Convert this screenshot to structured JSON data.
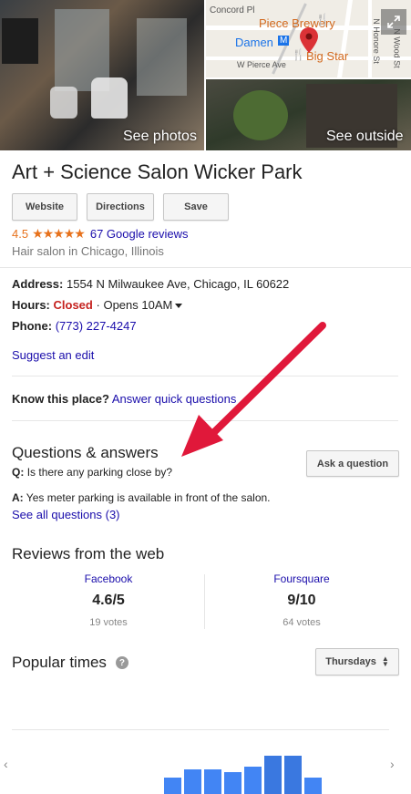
{
  "photos": {
    "main_label": "See photos",
    "outside_label": "See outside",
    "map_labels": [
      "Concord Pl",
      "Piece Brewery",
      "Damen",
      "Big Star",
      "W Pierce Ave",
      "N Honore St",
      "N Wood St"
    ],
    "expand_icon": "expand-icon"
  },
  "business": {
    "name": "Art + Science Salon Wicker Park",
    "buttons": [
      "Website",
      "Directions",
      "Save"
    ],
    "rating": "4.5",
    "stars": "★★★★★",
    "reviews_link": "67 Google reviews",
    "category": "Hair salon in Chicago, Illinois"
  },
  "info": {
    "address_label": "Address:",
    "address": "1554 N Milwaukee Ave, Chicago, IL 60622",
    "hours_label": "Hours:",
    "hours_status": "Closed",
    "hours_sep": "·",
    "hours_next": "Opens 10AM",
    "phone_label": "Phone:",
    "phone": "(773) 227-4247",
    "suggest_edit": "Suggest an edit",
    "know_label": "Know this place?",
    "know_link": "Answer quick questions"
  },
  "qa": {
    "title": "Questions & answers",
    "ask_button": "Ask a question",
    "q_prefix": "Q:",
    "question": "Is there any parking close by?",
    "a_prefix": "A:",
    "answer": "Yes meter parking is available in front of the salon.",
    "see_all": "See all questions (3)"
  },
  "reviews_web": {
    "title": "Reviews from the web",
    "sources": [
      {
        "name": "Facebook",
        "score": "4.6/5",
        "votes": "19 votes"
      },
      {
        "name": "Foursquare",
        "score": "9/10",
        "votes": "64 votes"
      }
    ]
  },
  "popular_times": {
    "title": "Popular times",
    "help_icon": "?",
    "day": "Thursdays",
    "bar_levels": [
      0.3,
      0.45,
      0.45,
      0.4,
      0.5,
      0.7,
      0.7,
      0.3
    ]
  },
  "colors": {
    "accent_link": "#1a0dab",
    "closed": "#c5221f",
    "star": "#e7711b",
    "annotation_arrow": "#e0183a",
    "bars": "#4285f4"
  }
}
